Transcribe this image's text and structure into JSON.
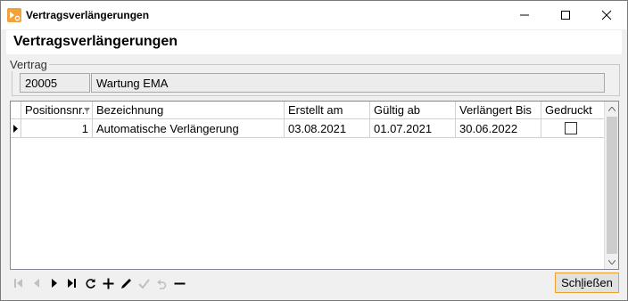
{
  "window": {
    "title": "Vertragsverlängerungen",
    "heading": "Vertragsverlängerungen"
  },
  "vertrag": {
    "legend": "Vertrag",
    "number": "20005",
    "name": "Wartung EMA"
  },
  "grid": {
    "columns": [
      "Positionsnr.",
      "Bezeichnung",
      "Erstellt am",
      "Gültig ab",
      "Verlängert Bis",
      "Gedruckt"
    ],
    "rows": [
      {
        "positionsnr": "1",
        "bezeichnung": "Automatische Verlängerung",
        "erstellt_am": "03.08.2021",
        "gueltig_ab": "01.07.2021",
        "verlaengert_bis": "30.06.2022",
        "gedruckt": false
      }
    ]
  },
  "navigator": {
    "icons": [
      "first-icon",
      "prior-icon",
      "next-icon",
      "last-icon",
      "refresh-icon",
      "insert-icon",
      "edit-icon",
      "post-icon",
      "cancel-icon",
      "delete-icon"
    ]
  },
  "buttons": {
    "close_prefix": "Sch",
    "close_key": "l",
    "close_suffix": "ießen"
  },
  "colors": {
    "accent": "#f2a23a",
    "focus_border": "#f0a030"
  }
}
